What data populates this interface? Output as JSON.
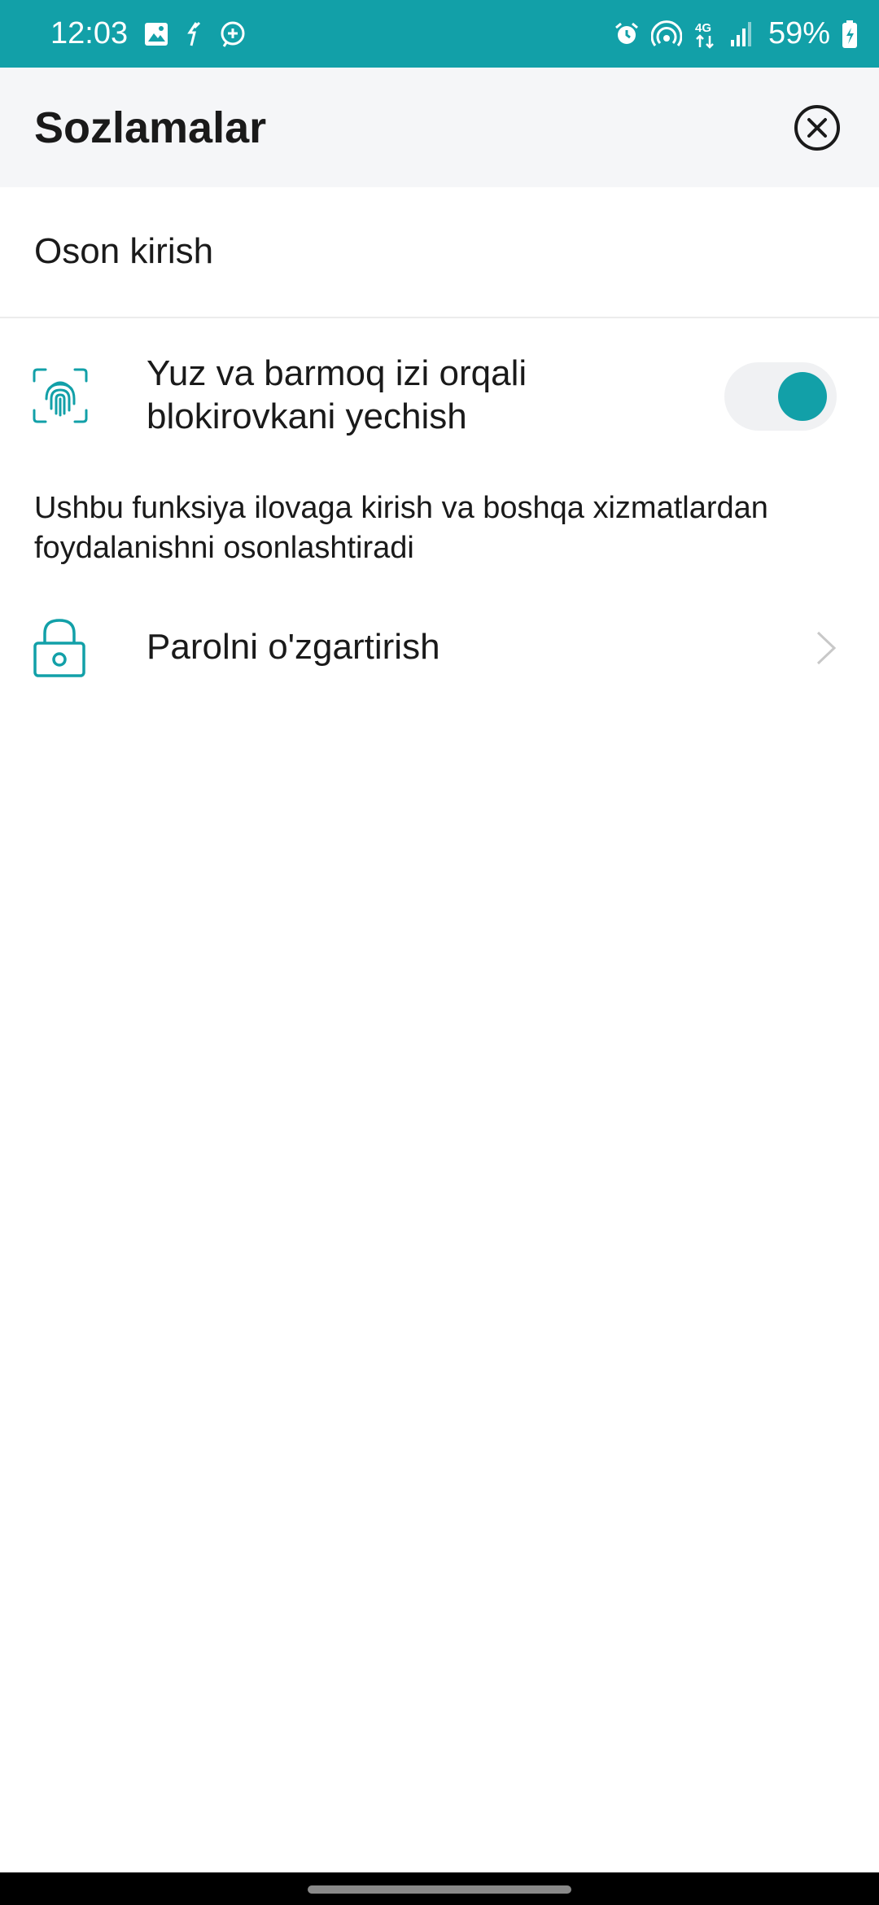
{
  "status_bar": {
    "time": "12:03",
    "battery": "59%",
    "network": "4G",
    "left_icons": [
      "gallery-icon",
      "sync-icon",
      "chat-icon"
    ],
    "right_icons": [
      "alarm-icon",
      "hotspot-icon",
      "network-4g-icon",
      "signal-icon",
      "battery-charging-icon"
    ]
  },
  "header": {
    "title": "Sozlamalar",
    "close_icon": "close-circle-icon"
  },
  "section": {
    "title": "Oson kirish"
  },
  "biometric": {
    "label": "Yuz va barmoq izi orqali blokirovkani yechish",
    "enabled": true,
    "icon": "fingerprint-scan-icon",
    "description": "Ushbu funksiya ilovaga kirish va boshqa xizmatlardan foydalanishni osonlashtiradi"
  },
  "password": {
    "label": "Parolni o'zgartirish",
    "icon": "lock-icon",
    "chevron": "chevron-right-icon"
  },
  "colors": {
    "accent": "#12a0a8",
    "header_bg": "#f5f6f8",
    "background": "#ffffff",
    "text": "#1a1a1a"
  }
}
